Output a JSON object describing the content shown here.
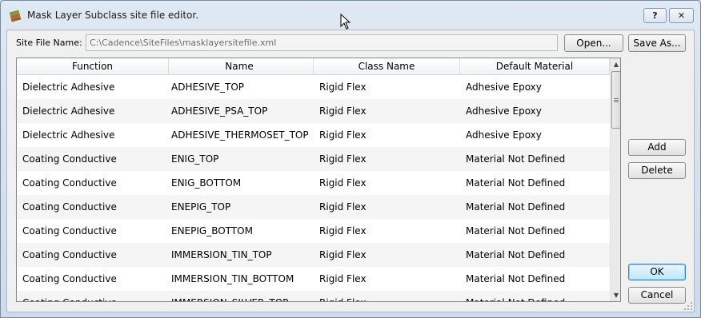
{
  "window": {
    "title": "Mask Layer Subclass site file editor.",
    "help_label": "?",
    "close_label": "✕"
  },
  "site_file": {
    "label": "Site File Name:",
    "value": "C:\\Cadence\\SiteFiles\\masklayersitefile.xml"
  },
  "buttons": {
    "open": "Open...",
    "save_as": "Save As...",
    "add": "Add",
    "delete": "Delete",
    "ok": "OK",
    "cancel": "Cancel"
  },
  "table": {
    "columns": [
      "Function",
      "Name",
      "Class Name",
      "Default Material"
    ],
    "rows": [
      [
        "Dielectric Adhesive",
        "ADHESIVE_TOP",
        "Rigid Flex",
        "Adhesive Epoxy"
      ],
      [
        "Dielectric Adhesive",
        "ADHESIVE_PSA_TOP",
        "Rigid Flex",
        "Adhesive Epoxy"
      ],
      [
        "Dielectric Adhesive",
        "ADHESIVE_THERMOSET_TOP",
        "Rigid Flex",
        "Adhesive Epoxy"
      ],
      [
        "Coating Conductive",
        "ENIG_TOP",
        "Rigid Flex",
        "Material Not Defined"
      ],
      [
        "Coating Conductive",
        "ENIG_BOTTOM",
        "Rigid Flex",
        "Material Not Defined"
      ],
      [
        "Coating Conductive",
        "ENEPIG_TOP",
        "Rigid Flex",
        "Material Not Defined"
      ],
      [
        "Coating Conductive",
        "ENEPIG_BOTTOM",
        "Rigid Flex",
        "Material Not Defined"
      ],
      [
        "Coating Conductive",
        "IMMERSION_TIN_TOP",
        "Rigid Flex",
        "Material Not Defined"
      ],
      [
        "Coating Conductive",
        "IMMERSION_TIN_BOTTOM",
        "Rigid Flex",
        "Material Not Defined"
      ],
      [
        "Coating Conductive",
        "IMMERSION_SILVER_TOP",
        "Rigid Flex",
        "Material Not Defined"
      ]
    ]
  },
  "icons": {
    "app": "layers-icon",
    "cursor": "mouse-pointer-icon",
    "scroll_up": "scroll-up-arrow-icon",
    "scroll_down": "scroll-down-arrow-icon"
  },
  "colors": {
    "window_frame": "#c9d8e9",
    "client_bg": "#f0f0f0",
    "alt_row": "#f5f5f5",
    "ok_button": "#bee6fd"
  }
}
